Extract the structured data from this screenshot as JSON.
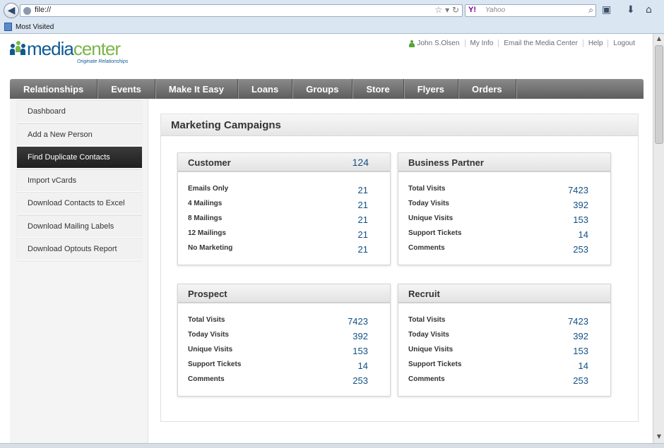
{
  "browser": {
    "url": "file://",
    "search_engine": "Y!",
    "search_placeholder": "Yahoo",
    "bookmarks_label": "Most Visited"
  },
  "header": {
    "logo_media": "media",
    "logo_center": "center",
    "logo_tagline": "Originate Relationships",
    "user_name": "John S.Olsen",
    "links": [
      "My Info",
      "Email the Media Center",
      "Help",
      "Logout"
    ]
  },
  "nav": {
    "items": [
      "Relationships",
      "Events",
      "Make It Easy",
      "Loans",
      "Groups",
      "Store",
      "Flyers",
      "Orders"
    ]
  },
  "sidebar": {
    "items": [
      "Dashboard",
      "Add a New Person",
      "Find Duplicate Contacts",
      "Import vCards",
      "Download Contacts to Excel",
      "Download Mailing Labels",
      "Download Optouts Report"
    ],
    "active_index": 2
  },
  "content": {
    "title": "Marketing Campaigns",
    "cards": [
      {
        "title": "Customer",
        "count": "124",
        "rows": [
          {
            "label": "Emails Only",
            "value": "21"
          },
          {
            "label": "4 Mailings",
            "value": "21"
          },
          {
            "label": "8 Mailings",
            "value": "21"
          },
          {
            "label": "12 Mailings",
            "value": "21"
          },
          {
            "label": "No Marketing",
            "value": "21"
          }
        ]
      },
      {
        "title": "Business Partner",
        "count": "",
        "rows": [
          {
            "label": "Total Visits",
            "value": "7423"
          },
          {
            "label": "Today Visits",
            "value": "392"
          },
          {
            "label": "Unique Visits",
            "value": "153"
          },
          {
            "label": "Support Tickets",
            "value": "14"
          },
          {
            "label": "Comments",
            "value": "253"
          }
        ]
      },
      {
        "title": "Prospect",
        "count": "",
        "rows": [
          {
            "label": "Total Visits",
            "value": "7423"
          },
          {
            "label": "Today Visits",
            "value": "392"
          },
          {
            "label": "Unique Visits",
            "value": "153"
          },
          {
            "label": "Support Tickets",
            "value": "14"
          },
          {
            "label": "Comments",
            "value": "253"
          }
        ]
      },
      {
        "title": "Recruit",
        "count": "",
        "rows": [
          {
            "label": "Total Visits",
            "value": "7423"
          },
          {
            "label": "Today Visits",
            "value": "392"
          },
          {
            "label": "Unique Visits",
            "value": "153"
          },
          {
            "label": "Support Tickets",
            "value": "14"
          },
          {
            "label": "Comments",
            "value": "253"
          }
        ]
      }
    ]
  },
  "colors": {
    "brand_blue": "#0d5a94",
    "brand_green": "#7ab648",
    "value_blue": "#134f85",
    "nav_gray": "#6e6e6e"
  }
}
